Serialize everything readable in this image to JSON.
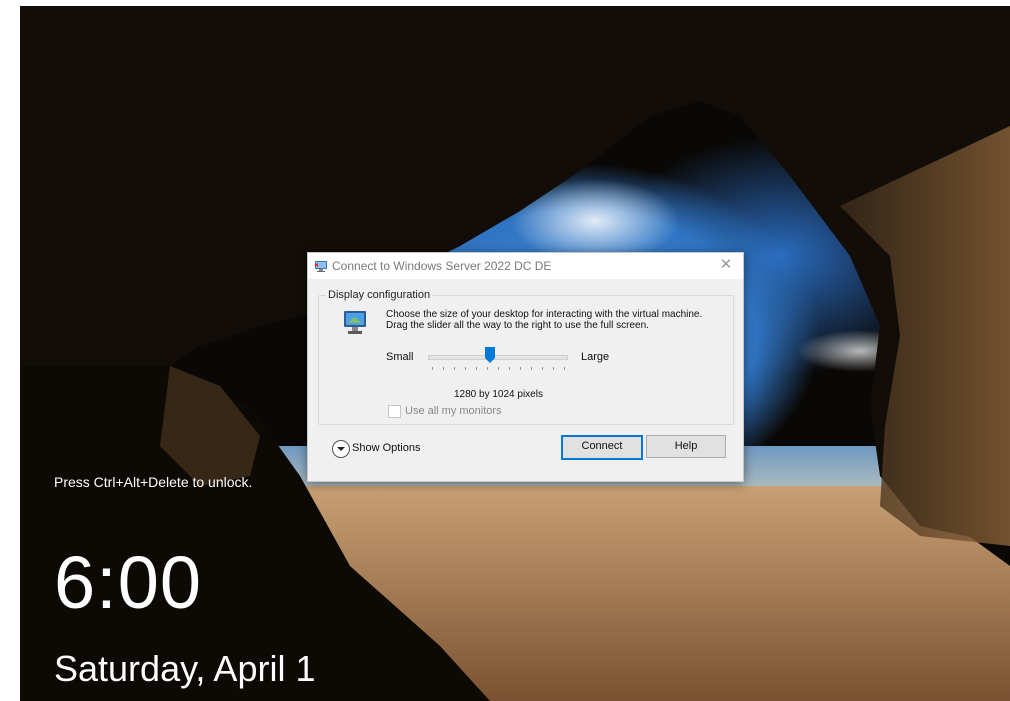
{
  "lockscreen": {
    "unlock_hint": "Press Ctrl+Alt+Delete to unlock.",
    "time": "6:00",
    "date": "Saturday, April 1"
  },
  "dialog": {
    "title": "Connect to Windows Server 2022 DC DE",
    "close_icon": "close-icon",
    "group_label": "Display configuration",
    "description": "Choose the size of your desktop for interacting with the virtual machine. Drag the slider all the way to the right to use the full screen.",
    "slider": {
      "min_label": "Small",
      "max_label": "Large",
      "value_fraction": 0.45,
      "tick_count": 13
    },
    "resolution_text": "1280 by 1024 pixels",
    "use_all_monitors_label": "Use all my monitors",
    "use_all_monitors_checked": false,
    "show_options_label": "Show Options",
    "connect_label": "Connect",
    "help_label": "Help"
  },
  "colors": {
    "accent": "#0078d7",
    "dialog_bg": "#f0f0f0",
    "sky": "#2f74c2"
  }
}
